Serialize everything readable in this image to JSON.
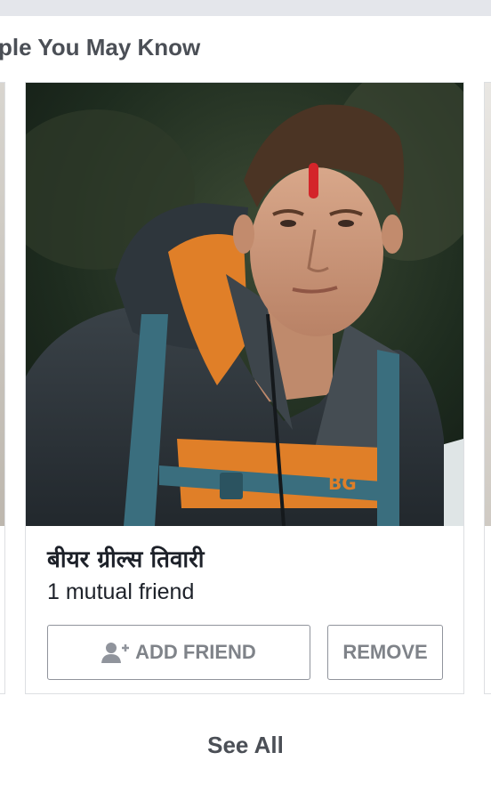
{
  "section": {
    "title": "ple You May Know"
  },
  "suggestion": {
    "name": "बीयर ग्रील्स तिवारी",
    "mutual": "1 mutual friend",
    "add_label": "ADD FRIEND",
    "remove_label": "REMOVE",
    "jacket_logo": "BG"
  },
  "footer": {
    "see_all": "See All"
  },
  "icons": {
    "add_friend": "person-plus-icon"
  },
  "colors": {
    "title_text": "#4b4f56",
    "button_text": "#7f8389",
    "border": "#dddfe2"
  }
}
